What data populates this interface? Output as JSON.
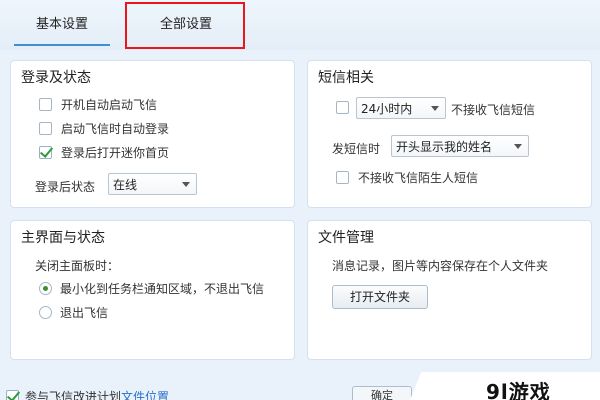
{
  "tabs": [
    {
      "label": "基本设置"
    },
    {
      "label": "全部设置"
    }
  ],
  "login_panel": {
    "title": "登录及状态",
    "options": [
      {
        "label": "开机自动启动飞信",
        "checked": false
      },
      {
        "label": "启动飞信时自动登录",
        "checked": false
      },
      {
        "label": "登录后打开迷你首页",
        "checked": true
      }
    ],
    "status_label": "登录后状态",
    "status_value": "在线"
  },
  "sms_panel": {
    "title": "短信相关",
    "time_value": "24小时内",
    "no_receive_label": "不接收飞信短信",
    "send_label": "发短信时",
    "send_value": "开头显示我的姓名",
    "stranger_label": "不接收飞信陌生人短信"
  },
  "main_panel": {
    "title": "主界面与状态",
    "close_label": "关闭主面板时：",
    "options": [
      {
        "label": "最小化到任务栏通知区域，不退出飞信",
        "selected": true
      },
      {
        "label": "退出飞信",
        "selected": false
      }
    ]
  },
  "file_panel": {
    "title": "文件管理",
    "desc": "消息记录，图片等内容保存在个人文件夹",
    "open_button": "打开文件夹"
  },
  "bottom": {
    "text": "参与飞信改进计划",
    "link": "文件位置",
    "button": "确定"
  },
  "watermark": "9l游戏"
}
